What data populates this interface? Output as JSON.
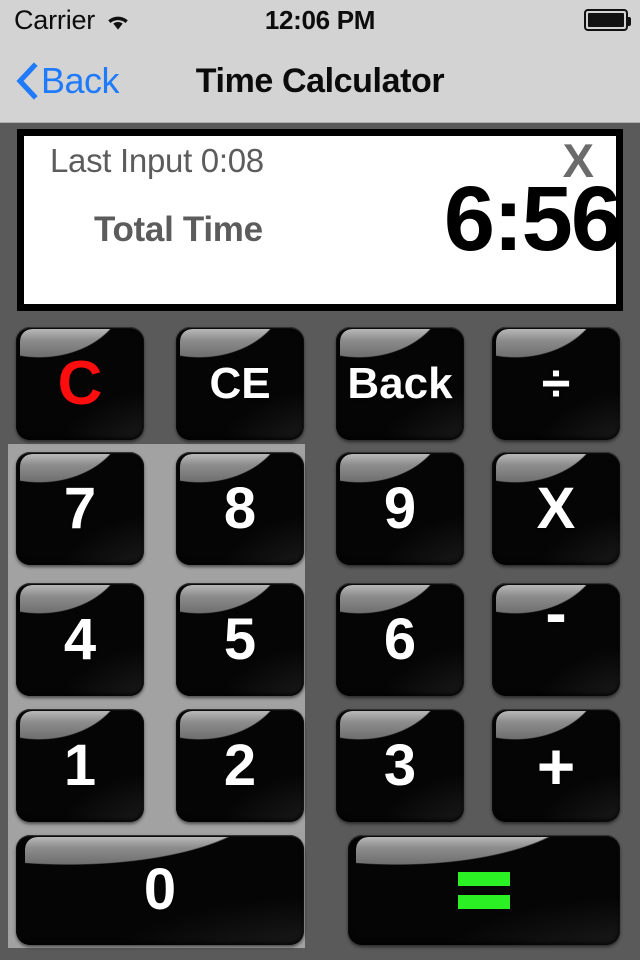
{
  "status_bar": {
    "carrier": "Carrier",
    "wifi_icon": "wifi-icon",
    "time": "12:06 PM",
    "battery_icon": "battery-full-icon"
  },
  "nav_bar": {
    "back_label": "Back",
    "back_icon": "chevron-left-icon",
    "title": "Time Calculator",
    "tint_color": "#1f7bfb"
  },
  "display": {
    "last_input_label": "Last Input 0:08",
    "operator": "X",
    "total_label": "Total Time",
    "total_value": "6:56",
    "background": "#ffffff",
    "border_color": "#000000",
    "text_color": "#5c5c5c",
    "value_color": "#000000"
  },
  "keypad": {
    "panel_color": "#a2a2a2",
    "background_color": "#5a5a5a",
    "function_row": [
      {
        "label": "C",
        "name": "key-clear",
        "color": "#fd0d0d"
      },
      {
        "label": "CE",
        "name": "key-clear-entry",
        "color": "#ffffff"
      },
      {
        "label": "Back",
        "name": "key-backspace",
        "color": "#ffffff"
      },
      {
        "label": "÷",
        "name": "key-divide",
        "color": "#ffffff"
      }
    ],
    "digits": [
      {
        "label": "7",
        "name": "key-7"
      },
      {
        "label": "8",
        "name": "key-8"
      },
      {
        "label": "9",
        "name": "key-9"
      },
      {
        "label": "4",
        "name": "key-4"
      },
      {
        "label": "5",
        "name": "key-5"
      },
      {
        "label": "6",
        "name": "key-6"
      },
      {
        "label": "1",
        "name": "key-1"
      },
      {
        "label": "2",
        "name": "key-2"
      },
      {
        "label": "3",
        "name": "key-3"
      },
      {
        "label": "0",
        "name": "key-0"
      }
    ],
    "operators": [
      {
        "label": "X",
        "name": "key-multiply"
      },
      {
        "label": "-",
        "name": "key-subtract"
      },
      {
        "label": "+",
        "name": "key-add"
      }
    ],
    "equals": {
      "label": "=",
      "name": "key-equals",
      "color": "#2bf024"
    }
  }
}
